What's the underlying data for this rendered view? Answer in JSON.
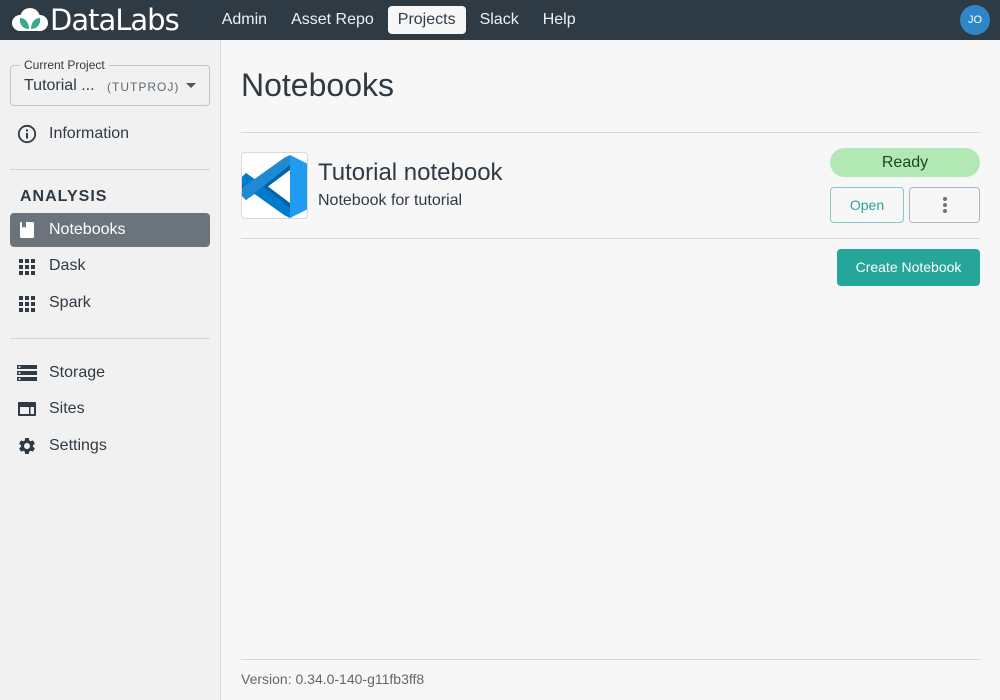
{
  "app": {
    "name": "DataLabs"
  },
  "topnav": {
    "items": [
      {
        "label": "Admin",
        "active": false
      },
      {
        "label": "Asset Repo",
        "active": false
      },
      {
        "label": "Projects",
        "active": true
      },
      {
        "label": "Slack",
        "active": false
      },
      {
        "label": "Help",
        "active": false
      }
    ],
    "user_initials": "JO"
  },
  "sidebar": {
    "project_select": {
      "legend": "Current Project",
      "name": "Tutorial ...",
      "key": "(TUTPROJ)"
    },
    "information": {
      "label": "Information",
      "icon": "info-icon"
    },
    "section_title": "ANALYSIS",
    "analysis_items": [
      {
        "label": "Notebooks",
        "icon": "notebook-icon",
        "active": true
      },
      {
        "label": "Dask",
        "icon": "grid-icon",
        "active": false
      },
      {
        "label": "Spark",
        "icon": "grid-icon",
        "active": false
      }
    ],
    "other_items": [
      {
        "label": "Storage",
        "icon": "storage-icon"
      },
      {
        "label": "Sites",
        "icon": "sites-icon"
      },
      {
        "label": "Settings",
        "icon": "gear-icon"
      }
    ]
  },
  "main": {
    "title": "Notebooks",
    "notebooks": [
      {
        "title": "Tutorial notebook",
        "description": "Notebook for tutorial",
        "type_icon": "vscode-icon",
        "status": "Ready",
        "open_label": "Open"
      }
    ],
    "create_label": "Create Notebook",
    "version": "Version: 0.34.0-140-g11fb3ff8"
  },
  "colors": {
    "topbar": "#2e3a44",
    "accent": "#26a69a",
    "status_ready_bg": "#b2e8b4",
    "active_sidebar": "#6b747c",
    "avatar": "#2e86c9"
  }
}
